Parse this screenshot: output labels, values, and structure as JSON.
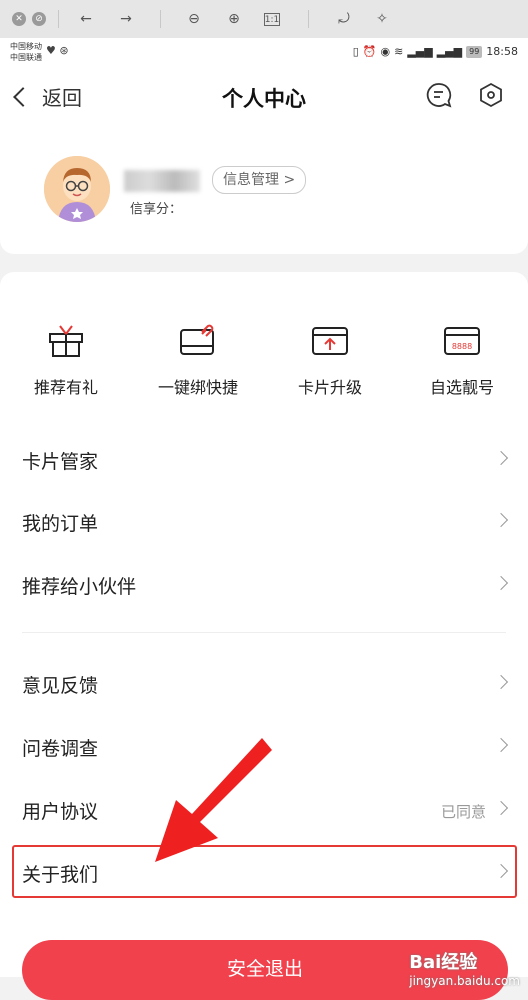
{
  "browser": {
    "buttons": [
      "close-tab",
      "stop",
      "back",
      "forward",
      "zoom-out",
      "zoom-in",
      "actual-size",
      "rotate",
      "magic"
    ]
  },
  "status_bar": {
    "carrier1": "中国移动",
    "carrier2": "中国联通",
    "battery": "99",
    "time": "18:58"
  },
  "header": {
    "back_label": "返回",
    "title": "个人中心"
  },
  "profile": {
    "manage_label": "信息管理 >",
    "score_label": "信享分："
  },
  "quick_actions": [
    {
      "label": "推荐有礼",
      "icon": "gift-icon"
    },
    {
      "label": "一键绑快捷",
      "icon": "card-link-icon"
    },
    {
      "label": "卡片升级",
      "icon": "card-upgrade-icon"
    },
    {
      "label": "自选靓号",
      "icon": "card-number-icon",
      "icon_text": "8888"
    }
  ],
  "menu": [
    {
      "label": "卡片管家",
      "value": ""
    },
    {
      "label": "我的订单",
      "value": ""
    },
    {
      "label": "推荐给小伙伴",
      "value": ""
    },
    {
      "label": "意见反馈",
      "value": ""
    },
    {
      "label": "问卷调查",
      "value": ""
    },
    {
      "label": "用户协议",
      "value": "已同意"
    },
    {
      "label": "关于我们",
      "value": ""
    }
  ],
  "logout_label": "安全退出",
  "watermark": {
    "main": "Bai经验",
    "sub": "jingyan.baidu.com"
  },
  "colors": {
    "accent": "#f0414d",
    "highlight": "#e53935"
  }
}
